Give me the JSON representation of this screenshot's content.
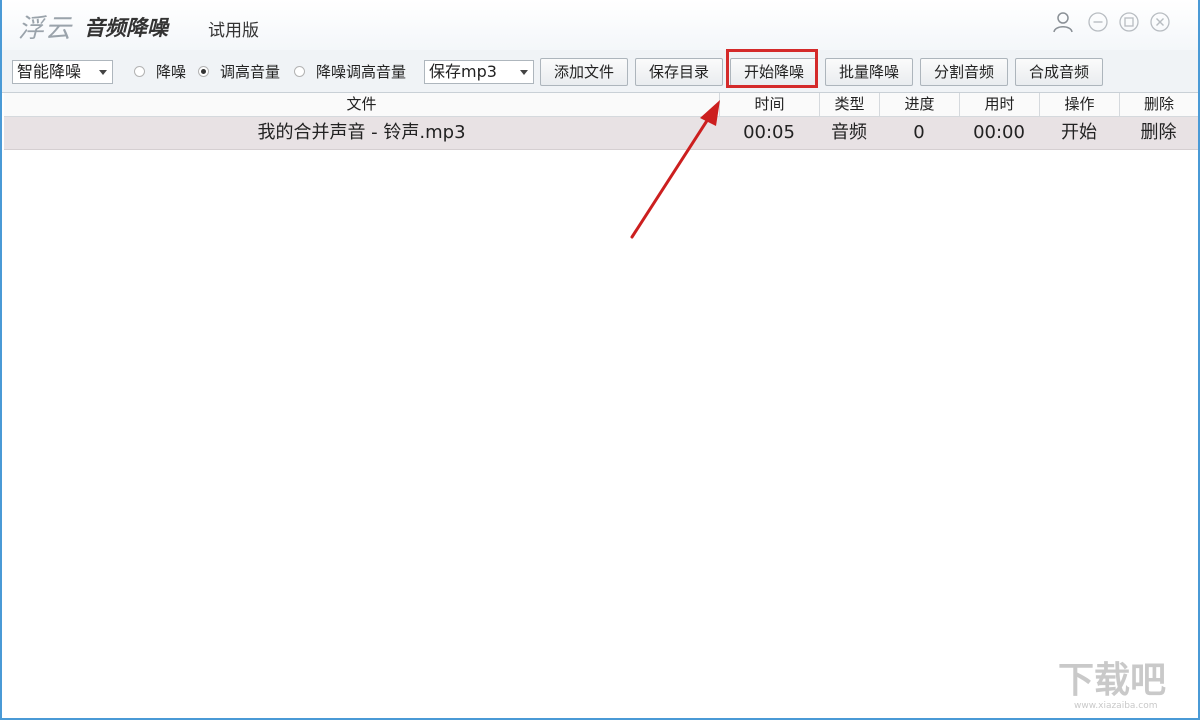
{
  "titlebar": {
    "logo_brand": "浮云",
    "app_name": "音频降噪",
    "edition": "试用版",
    "icons": [
      "user-icon",
      "minimize-icon",
      "maximize-icon",
      "close-icon"
    ]
  },
  "toolbar": {
    "mode_select": "智能降噪",
    "radios": [
      {
        "label": "降噪",
        "checked": false
      },
      {
        "label": "调高音量",
        "checked": true
      },
      {
        "label": "降噪调高音量",
        "checked": false
      }
    ],
    "format_select": "保存mp3",
    "buttons": {
      "add_file": "添加文件",
      "save_dir": "保存目录",
      "start": "开始降噪",
      "batch": "批量降噪",
      "split": "分割音频",
      "merge": "合成音频"
    }
  },
  "table": {
    "columns": [
      "文件",
      "时间",
      "类型",
      "进度",
      "用时",
      "操作",
      "删除"
    ],
    "rows": [
      {
        "file": "我的合并声音 - 铃声.mp3",
        "time": "00:05",
        "type": "音频",
        "progress": "0",
        "elapsed": "00:00",
        "action": "开始",
        "delete": "删除"
      }
    ]
  },
  "annotation": {
    "highlight_color": "#d42a2a",
    "arrow_color": "#cc1f1f"
  },
  "watermark": {
    "text": "下载吧",
    "url_text": "www.xiazaiba.com"
  },
  "colors": {
    "window_border": "#4a9ad6",
    "row_selected": "#e8e2e4",
    "toolbar_bg": "#f0f3f6"
  }
}
